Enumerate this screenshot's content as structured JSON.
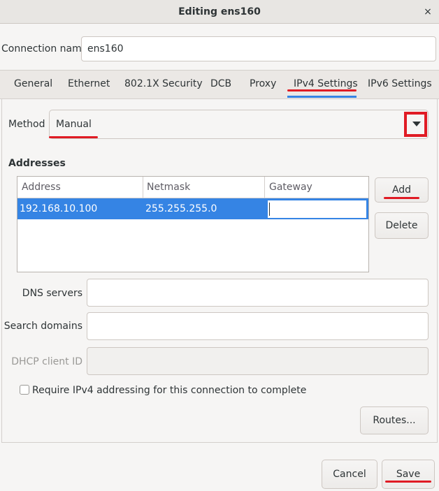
{
  "window": {
    "title": "Editing ens160",
    "close_glyph": "×"
  },
  "connection": {
    "name_label": "Connection name",
    "name_value": "ens160"
  },
  "tabs": [
    {
      "label": "General"
    },
    {
      "label": "Ethernet"
    },
    {
      "label": "802.1X Security"
    },
    {
      "label": "DCB"
    },
    {
      "label": "Proxy"
    },
    {
      "label": "IPv4 Settings",
      "active": true
    },
    {
      "label": "IPv6 Settings"
    }
  ],
  "method": {
    "label": "Method",
    "value": "Manual"
  },
  "addresses": {
    "heading": "Addresses",
    "columns": [
      "Address",
      "Netmask",
      "Gateway"
    ],
    "rows": [
      {
        "address": "192.168.10.100",
        "netmask": "255.255.255.0",
        "gateway": "",
        "selected": true
      }
    ],
    "add_label": "Add",
    "delete_label": "Delete"
  },
  "dns": {
    "label": "DNS servers",
    "value": ""
  },
  "search_domains": {
    "label": "Search domains",
    "value": ""
  },
  "dhcp_client_id": {
    "label": "DHCP client ID",
    "value": "",
    "disabled": true
  },
  "require_ipv4": {
    "label": "Require IPv4 addressing for this connection to complete",
    "checked": false
  },
  "routes_label": "Routes...",
  "footer": {
    "cancel_label": "Cancel",
    "save_label": "Save"
  },
  "colors": {
    "accent": "#3584e4",
    "annotation_red": "#e01b24"
  }
}
